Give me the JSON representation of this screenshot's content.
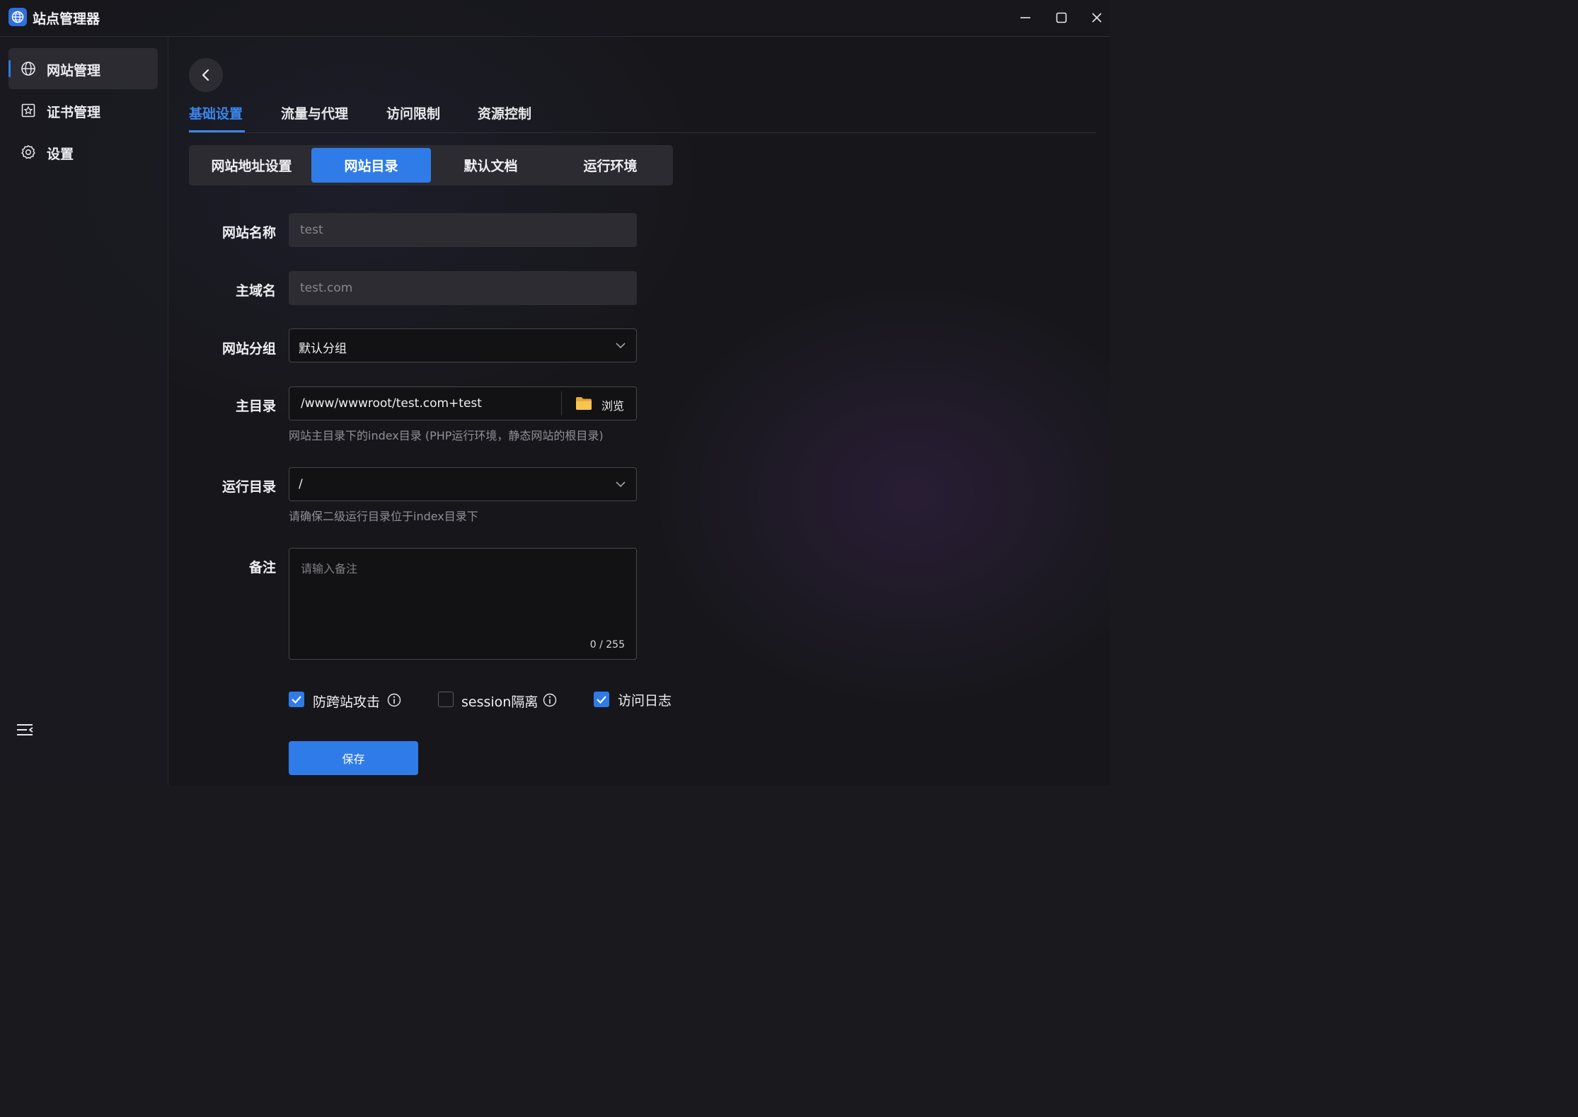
{
  "app": {
    "title": "站点管理器"
  },
  "sidebar": {
    "items": [
      {
        "label": "网站管理",
        "icon": "globe-icon",
        "active": true
      },
      {
        "label": "证书管理",
        "icon": "certificate-icon",
        "active": false
      },
      {
        "label": "设置",
        "icon": "gear-icon",
        "active": false
      }
    ]
  },
  "tabs": [
    {
      "label": "基础设置",
      "active": true
    },
    {
      "label": "流量与代理",
      "active": false
    },
    {
      "label": "访问限制",
      "active": false
    },
    {
      "label": "资源控制",
      "active": false
    }
  ],
  "segments": [
    {
      "label": "网站地址设置",
      "active": false
    },
    {
      "label": "网站目录",
      "active": true
    },
    {
      "label": "默认文档",
      "active": false
    },
    {
      "label": "运行环境",
      "active": false
    }
  ],
  "form": {
    "site_name": {
      "label": "网站名称",
      "value": "test"
    },
    "domain": {
      "label": "主域名",
      "value": "test.com"
    },
    "group": {
      "label": "网站分组",
      "value": "默认分组"
    },
    "root_dir": {
      "label": "主目录",
      "value": "/www/wwwroot/test.com+test",
      "browse_label": "浏览",
      "hint": "网站主目录下的index目录 (PHP运行环境，静态网站的根目录)"
    },
    "run_dir": {
      "label": "运行目录",
      "value": "/",
      "hint": "请确保二级运行目录位于index目录下"
    },
    "remark": {
      "label": "备注",
      "placeholder": "请输入备注",
      "counter": "0 / 255"
    },
    "options": [
      {
        "label": "防跨站攻击",
        "checked": true,
        "info": true
      },
      {
        "label": "session隔离",
        "checked": false,
        "info": true
      },
      {
        "label": "访问日志",
        "checked": true,
        "info": false
      }
    ],
    "save_label": "保存"
  },
  "colors": {
    "accent": "#2f7be8",
    "background": "#17171b"
  }
}
